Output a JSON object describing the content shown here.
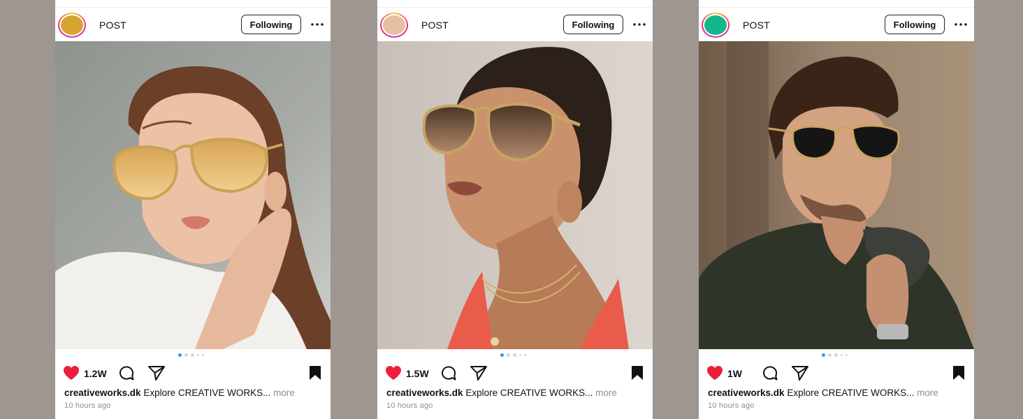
{
  "colors": {
    "background": "#9e9690",
    "like": "#ed1e3c",
    "active_dot": "#3897f0"
  },
  "posts": [
    {
      "username": "POST",
      "avatar_color": "#d4a531",
      "follow_label": "Following",
      "photo_description": "woman with auburn hair wearing gold aviator sunglasses with amber lenses",
      "likes": "1.2W",
      "caption_user": "creativeworks.dk",
      "caption_text": "Explore CREATIVE WORKS...",
      "more_label": "more",
      "time": "10 hours ago",
      "icons": [
        "heart-icon",
        "comment-icon",
        "share-icon",
        "bookmark-icon",
        "more-options-icon"
      ]
    },
    {
      "username": "POST",
      "avatar_color": "#e6bfa2",
      "follow_label": "Following",
      "photo_description": "woman with slicked back hair wearing gold aviator sunglasses with gradient brown lenses",
      "likes": "1.5W",
      "caption_user": "creativeworks.dk",
      "caption_text": "Explore CREATIVE WORKS...",
      "more_label": "more",
      "time": "10 hours ago",
      "icons": [
        "heart-icon",
        "comment-icon",
        "share-icon",
        "bookmark-icon",
        "more-options-icon"
      ]
    },
    {
      "username": "POST",
      "avatar_color": "#13b88a",
      "follow_label": "Following",
      "photo_description": "man in dark polo shirt wearing gold aviator sunglasses with black lenses",
      "likes": "1W",
      "caption_user": "creativeworks.dk",
      "caption_text": "Explore CREATIVE WORKS...",
      "more_label": "more",
      "time": "10 hours ago",
      "icons": [
        "heart-icon",
        "comment-icon",
        "share-icon",
        "bookmark-icon",
        "more-options-icon"
      ]
    }
  ],
  "carousel": {
    "dot_count": 5,
    "active_index": 0
  }
}
